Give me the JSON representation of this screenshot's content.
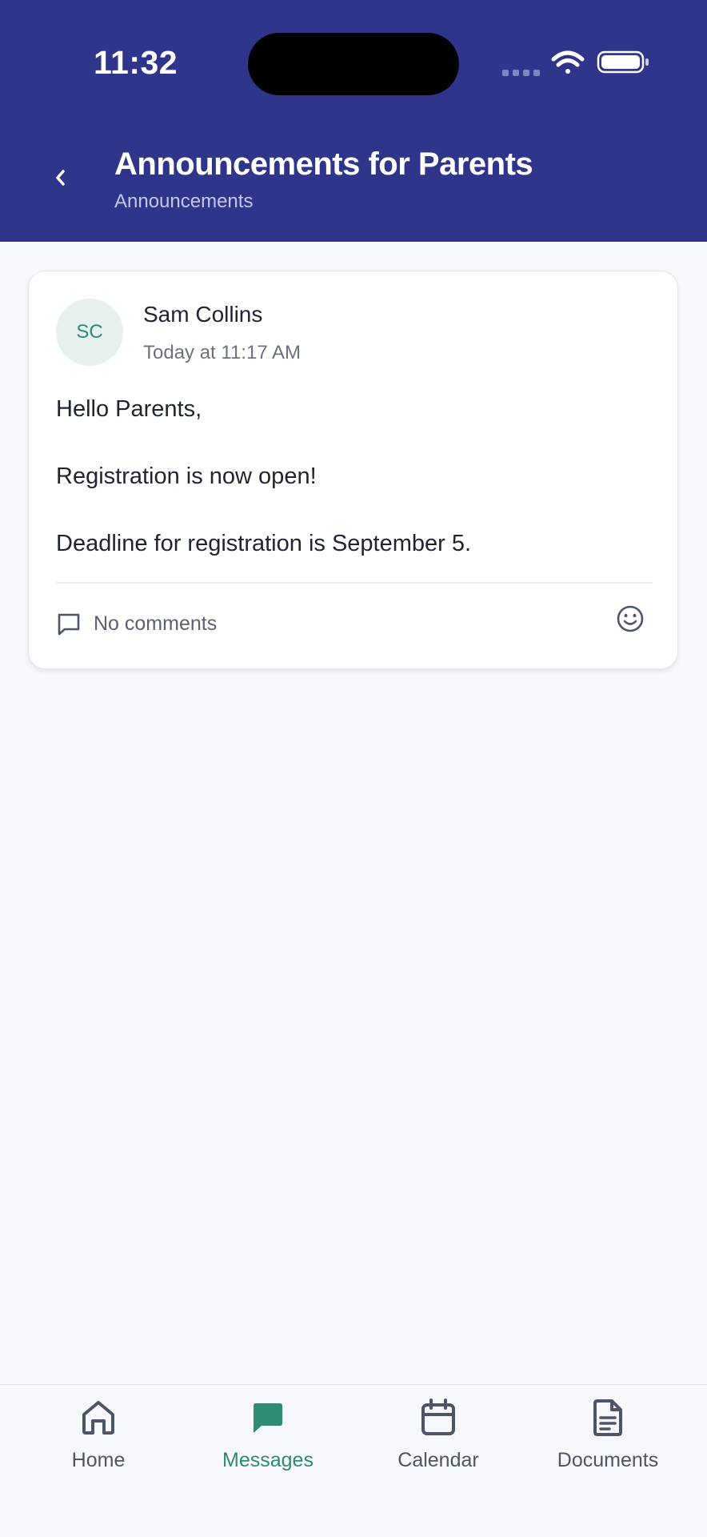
{
  "status_bar": {
    "time": "11:32"
  },
  "header": {
    "title": "Announcements for Parents",
    "subtitle": "Announcements",
    "background": "#2e358a"
  },
  "post": {
    "avatar_initials": "SC",
    "author": "Sam Collins",
    "timestamp": "Today at 11:17 AM",
    "body_lines": [
      "Hello Parents,",
      "Registration is now open!",
      "Deadline for registration is September 5."
    ],
    "comments_label": "No comments",
    "comments_icon": "comment-icon",
    "react_icon": "smiley-icon"
  },
  "nav": {
    "items": [
      {
        "label": "Home",
        "icon": "home-icon",
        "active": false
      },
      {
        "label": "Messages",
        "icon": "message-icon",
        "active": true
      },
      {
        "label": "Calendar",
        "icon": "calendar-icon",
        "active": false
      },
      {
        "label": "Documents",
        "icon": "document-icon",
        "active": false
      }
    ],
    "active_color": "#2e8a74",
    "inactive_color": "#4e5566"
  }
}
